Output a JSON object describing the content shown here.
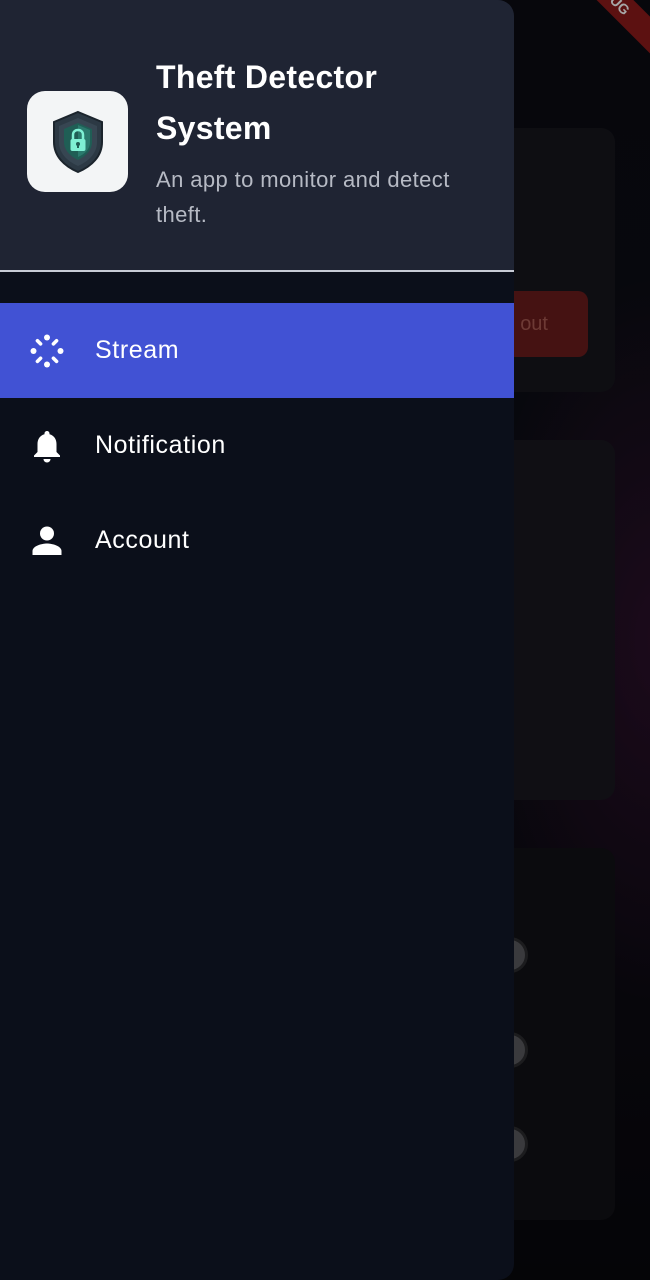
{
  "app": {
    "title": "Theft Detector System",
    "subtitle": "An app to monitor and detect theft."
  },
  "drawer": {
    "items": [
      {
        "label": "Stream",
        "icon": "stream-icon",
        "active": true
      },
      {
        "label": "Notification",
        "icon": "bell-icon",
        "active": false
      },
      {
        "label": "Account",
        "icon": "person-icon",
        "active": false
      }
    ]
  },
  "background": {
    "logout_button_label": "out",
    "debug_banner": "UG"
  },
  "colors": {
    "drawer_bg": "#0b0f1a",
    "header_bg": "#1f2433",
    "active_item": "#4152d4",
    "logout_button": "#6b1d1d"
  }
}
